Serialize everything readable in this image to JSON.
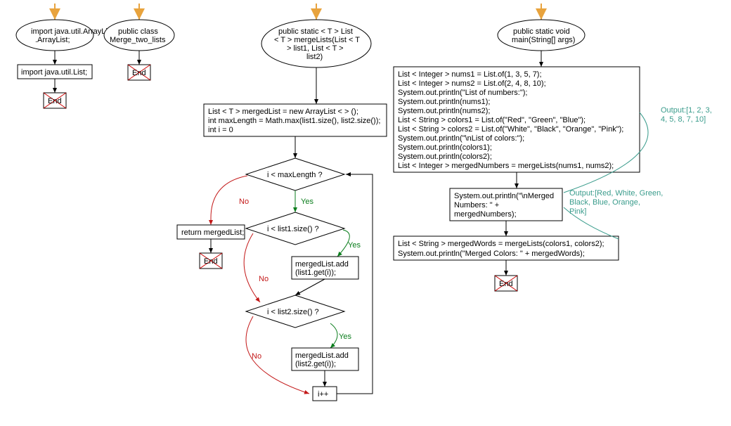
{
  "flowcharts": [
    {
      "id": "fc1",
      "entry": "import java.util.ArrayList;",
      "box1": "import java.util.List;",
      "end": "End"
    },
    {
      "id": "fc2",
      "entry": "public class\nMerge_two_lists",
      "end": "End"
    },
    {
      "id": "fc3",
      "entry": "public static < T > List\n< T > mergeLists(List < T\n> list1, List < T >\nlist2)",
      "init": "List < T > mergedList = new ArrayList < > ();\nint maxLength = Math.max(list1.size(), list2.size());\nint i = 0",
      "cond1": "i < maxLength ?",
      "return": "return mergedList;",
      "cond2": "i < list1.size() ?",
      "add1": "mergedList.add\n(list1.get(i));",
      "cond3": "i < list2.size() ?",
      "add2": "mergedList.add\n(list2.get(i));",
      "inc": "i++",
      "end": "End",
      "yes": "Yes",
      "no": "No"
    },
    {
      "id": "fc4",
      "entry": "public static void\nmain(String[] args)",
      "block1_lines": [
        "List < Integer > nums1 = List.of(1, 3, 5, 7);",
        "List < Integer > nums2 = List.of(2, 4, 8, 10);",
        "System.out.println(\"List of numbers:\");",
        "System.out.println(nums1);",
        "System.out.println(nums2);",
        "List < String > colors1 = List.of(\"Red\", \"Green\", \"Blue\");",
        "List < String > colors2 = List.of(\"White\", \"Black\", \"Orange\", \"Pink\");",
        "System.out.println(\"\\nList of colors:\");",
        "System.out.println(colors1);",
        "System.out.println(colors2);",
        "List < Integer > mergedNumbers = mergeLists(nums1, nums2);"
      ],
      "block2": "System.out.println(\"\\nMerged\nNumbers: \" +\nmergedNumbers);",
      "block3_lines": [
        "List < String > mergedWords = mergeLists(colors1, colors2);",
        "System.out.println(\"Merged Colors: \" + mergedWords);"
      ],
      "end": "End",
      "output1": "Output:[1, 2, 3,\n4, 5, 8, 7, 10]",
      "output2": "Output:[Red, White, Green,\nBlack, Blue, Orange,\nPink]"
    }
  ]
}
